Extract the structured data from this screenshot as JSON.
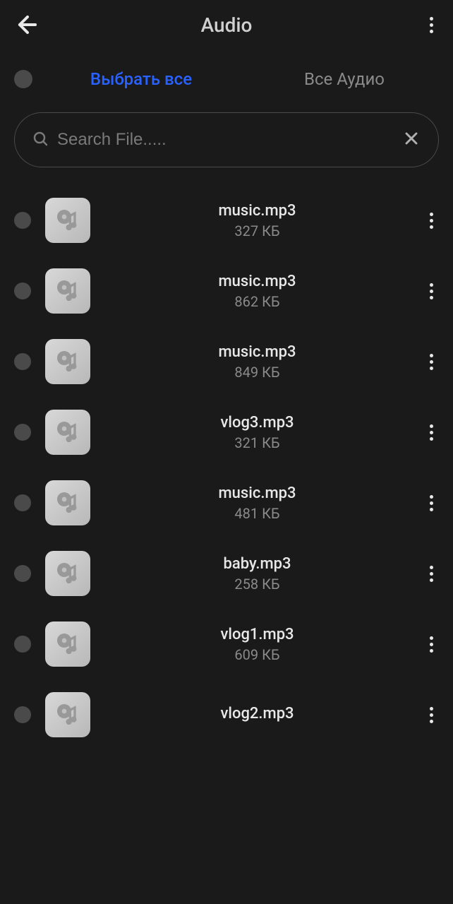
{
  "header": {
    "title": "Audio"
  },
  "tabs": {
    "select_all": "Выбрать все",
    "all_audio": "Все Аудио"
  },
  "search": {
    "placeholder": "Search File....."
  },
  "files": [
    {
      "name": "music.mp3",
      "size": "327 КБ"
    },
    {
      "name": "music.mp3",
      "size": "862 КБ"
    },
    {
      "name": "music.mp3",
      "size": "849 КБ"
    },
    {
      "name": "vlog3.mp3",
      "size": "321 КБ"
    },
    {
      "name": "music.mp3",
      "size": "481 КБ"
    },
    {
      "name": "baby.mp3",
      "size": "258 КБ"
    },
    {
      "name": "vlog1.mp3",
      "size": "609 КБ"
    },
    {
      "name": "vlog2.mp3",
      "size": ""
    }
  ]
}
